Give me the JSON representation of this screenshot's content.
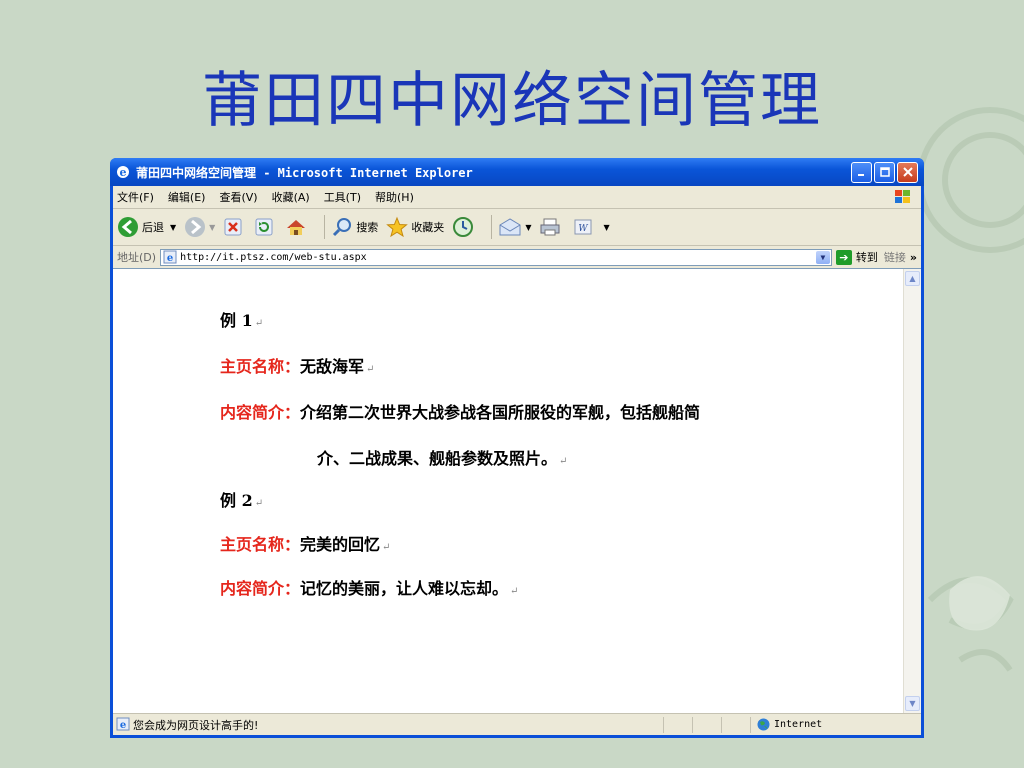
{
  "slide": {
    "title": "莆田四中网络空间管理"
  },
  "window": {
    "title": "莆田四中网络空间管理 - Microsoft Internet Explorer",
    "menu": [
      "文件(F)",
      "编辑(E)",
      "查看(V)",
      "收藏(A)",
      "工具(T)",
      "帮助(H)"
    ],
    "toolbar": {
      "back": "后退",
      "search": "搜索",
      "favorites": "收藏夹"
    },
    "address": {
      "label": "地址(D)",
      "url": "http://it.ptsz.com/web-stu.aspx",
      "go": "转到",
      "links": "链接"
    },
    "status": {
      "text": "您会成为网页设计高手的!",
      "zone": "Internet"
    }
  },
  "examples": [
    {
      "heading": "例 1",
      "name_label": "主页名称：",
      "name": "无敌海军",
      "desc_label": "内容简介：",
      "desc_line1": "介绍第二次世界大战参战各国所服役的军舰，包括舰船简",
      "desc_line2": "介、二战成果、舰船参数及照片。"
    },
    {
      "heading": "例 2",
      "name_label": "主页名称：",
      "name": "完美的回忆",
      "desc_label": "内容简介：",
      "desc_line1": "记忆的美丽，让人难以忘却。"
    }
  ],
  "para_mark": "↵"
}
